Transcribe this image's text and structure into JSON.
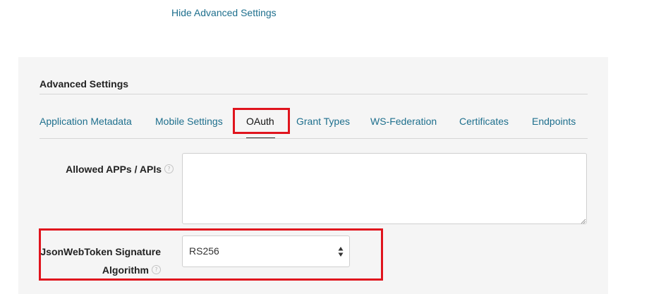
{
  "top": {
    "hide_advanced_link": "Hide Advanced Settings"
  },
  "advanced": {
    "title": "Advanced Settings",
    "tabs": [
      {
        "label": "Application Metadata"
      },
      {
        "label": "Mobile Settings"
      },
      {
        "label": "OAuth",
        "active": true
      },
      {
        "label": "Grant Types"
      },
      {
        "label": "WS-Federation"
      },
      {
        "label": "Certificates"
      },
      {
        "label": "Endpoints"
      }
    ]
  },
  "fields": {
    "allowed_apps": {
      "label": "Allowed APPs / APIs",
      "value": ""
    },
    "jwt_algorithm": {
      "label_line1": "JsonWebToken Signature",
      "label_line2": "Algorithm",
      "value": "RS256"
    }
  },
  "icons": {
    "help": "question-circle-icon",
    "select_arrows": "up-down-arrows-icon"
  },
  "colors": {
    "link": "#1e6f8d",
    "highlight": "#e0141d",
    "panel_bg": "#f5f5f5"
  }
}
